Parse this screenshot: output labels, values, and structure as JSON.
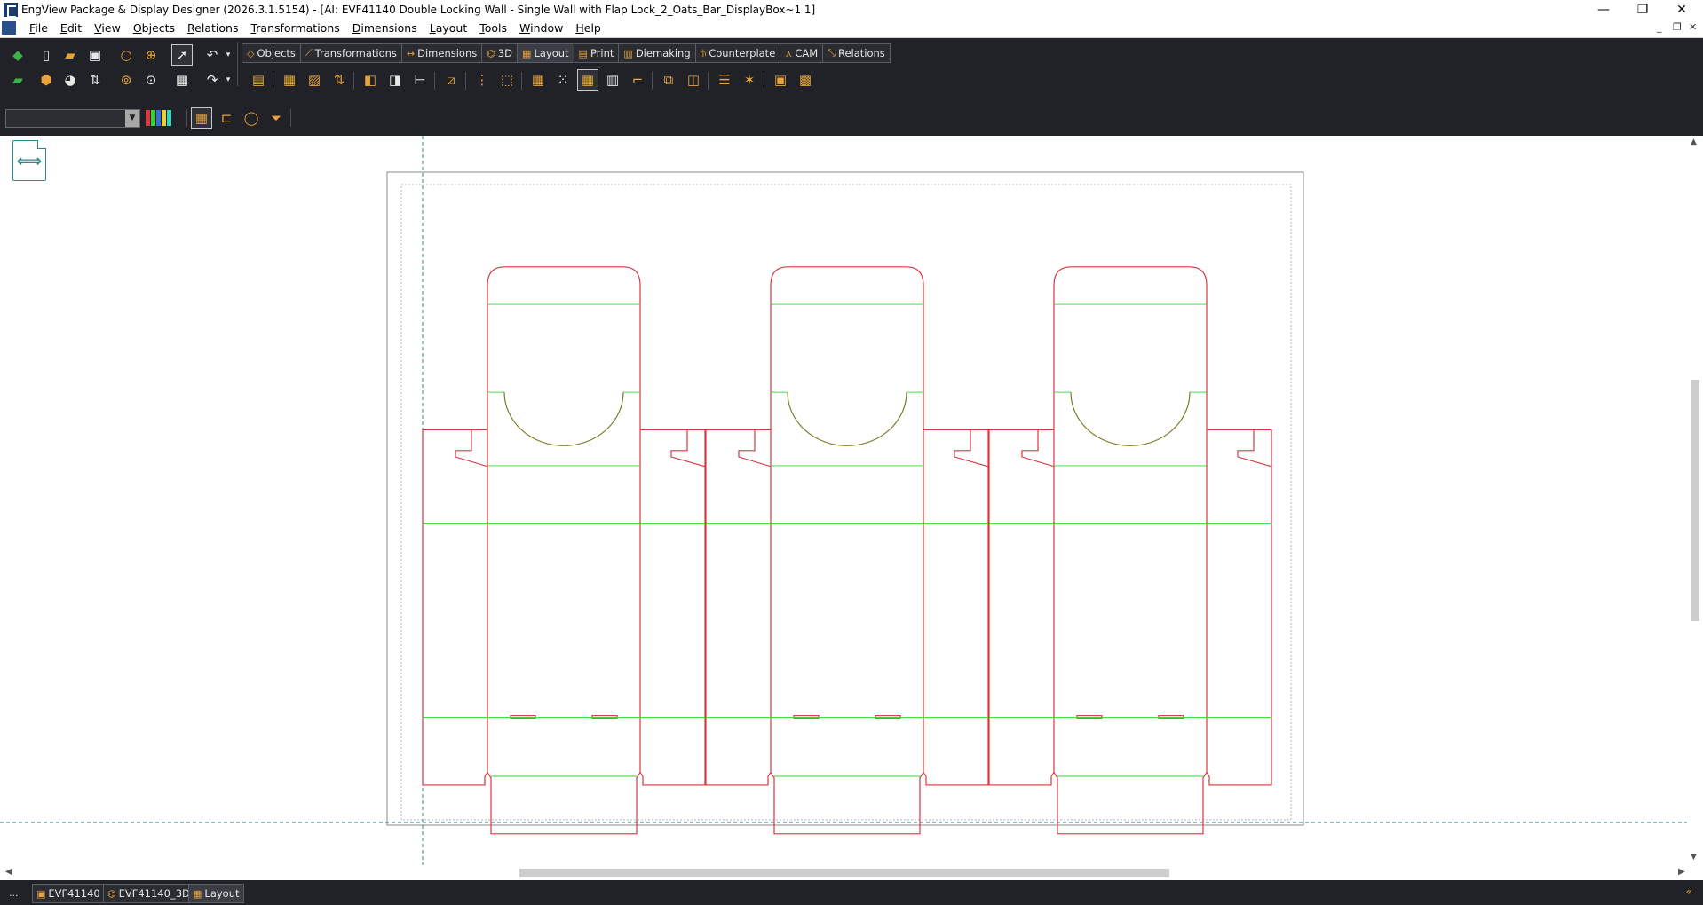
{
  "window": {
    "title": "EngView Package & Display Designer (2026.3.1.5154) - [AI: EVF41140 Double Locking Wall - Single Wall with Flap Lock_2_Oats_Bar_DisplayBox~1 1]",
    "minimize": "—",
    "restore": "❐",
    "close": "✕"
  },
  "menubar": {
    "items": [
      "File",
      "Edit",
      "View",
      "Objects",
      "Relations",
      "Transformations",
      "Dimensions",
      "Layout",
      "Tools",
      "Window",
      "Help"
    ],
    "mdi_min": "_",
    "mdi_restore": "❐",
    "mdi_close": "✕"
  },
  "toolbar": {
    "tabs": [
      {
        "label": "Objects",
        "icon": "objects-icon"
      },
      {
        "label": "Transformations",
        "icon": "transformations-icon"
      },
      {
        "label": "Dimensions",
        "icon": "dimensions-icon"
      },
      {
        "label": "3D",
        "icon": "3d-icon"
      },
      {
        "label": "Layout",
        "icon": "layout-icon"
      },
      {
        "label": "Print",
        "icon": "print-icon"
      },
      {
        "label": "Diemaking",
        "icon": "diemaking-icon"
      },
      {
        "label": "Counterplate",
        "icon": "counterplate-icon"
      },
      {
        "label": "CAM",
        "icon": "cam-icon"
      },
      {
        "label": "Relations",
        "icon": "relations-icon"
      }
    ],
    "selected_tab": "Layout",
    "layer_combo_value": ""
  },
  "colors": {
    "cut_line": "#d9363e",
    "crease_line": "#2ed82e",
    "perforation": "#7a7a22",
    "guide_line": "#2a8a8a",
    "accent": "#e8a33a",
    "toolbar_bg": "#202227"
  },
  "document_tabs": [
    {
      "label": "EVF41140",
      "icon": "design-icon"
    },
    {
      "label": "EVF41140_3D",
      "icon": "3d-icon"
    },
    {
      "label": "Layout",
      "icon": "layout-icon"
    }
  ],
  "status": {
    "more": "..."
  }
}
